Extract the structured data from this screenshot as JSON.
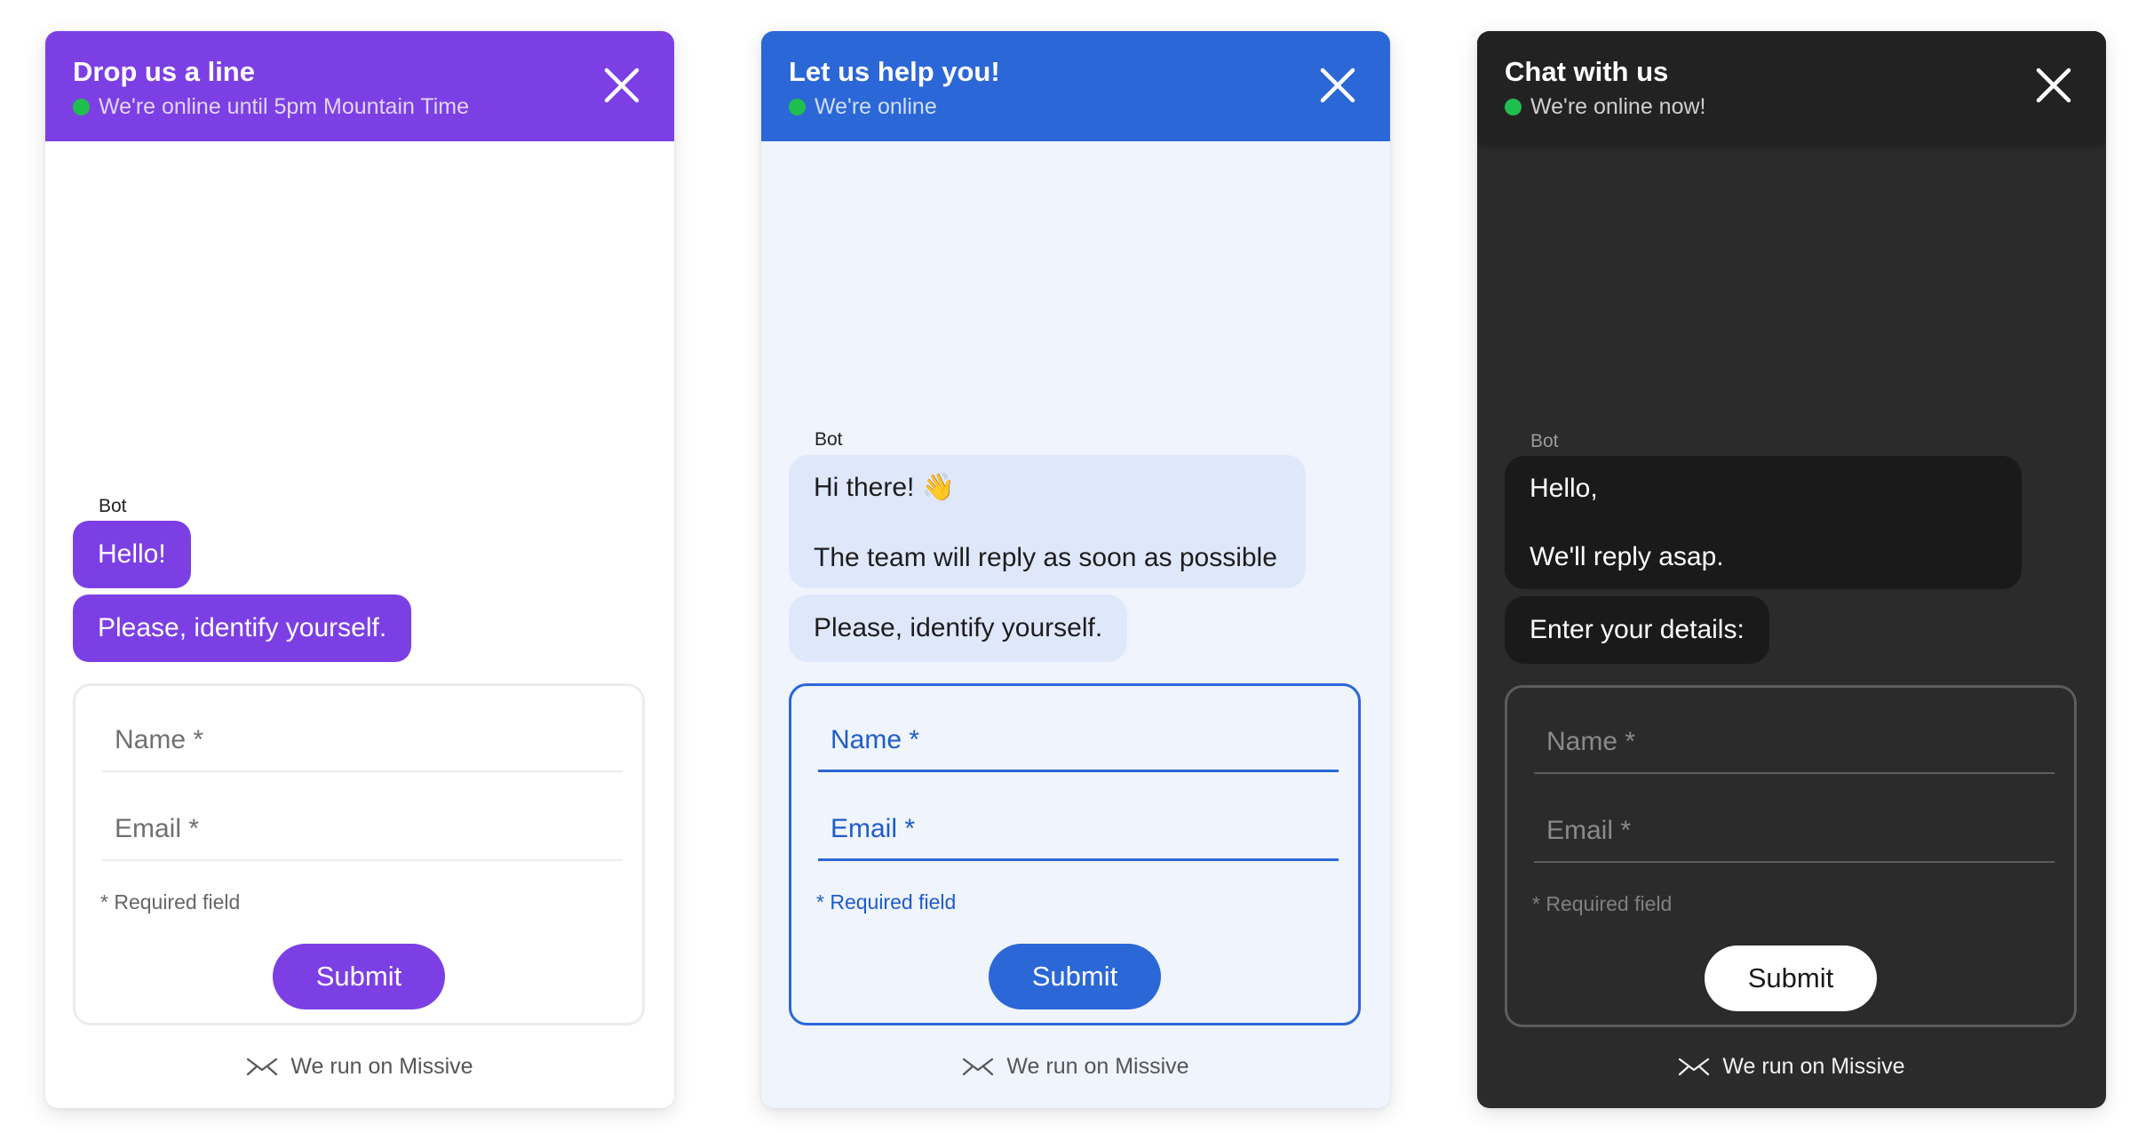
{
  "widgets": [
    {
      "title": "Drop us a line",
      "status": "We're online until 5pm Mountain Time",
      "bot_label": "Bot",
      "messages": [
        "Hello!",
        "Please, identify yourself."
      ],
      "form": {
        "name_placeholder": "Name *",
        "email_placeholder": "Email *",
        "required_note": "* Required field",
        "submit_label": "Submit"
      },
      "footer": "We run on Missive",
      "accent": "#7c3fe4",
      "theme": "light"
    },
    {
      "title": "Let us help you!",
      "status": "We're online",
      "bot_label": "Bot",
      "messages": [
        {
          "lines": [
            "Hi there! 👋",
            "The team will reply as soon as possible"
          ]
        },
        "Please, identify yourself."
      ],
      "form": {
        "name_placeholder": "Name *",
        "email_placeholder": "Email *",
        "required_note": "* Required field",
        "submit_label": "Submit"
      },
      "footer": "We run on Missive",
      "accent": "#2b67d6",
      "theme": "light-blue"
    },
    {
      "title": "Chat with us",
      "status": "We're online now!",
      "bot_label": "Bot",
      "messages": [
        {
          "lines": [
            "Hello,",
            "We'll reply asap."
          ]
        },
        "Enter your details:"
      ],
      "form": {
        "name_placeholder": "Name *",
        "email_placeholder": "Email *",
        "required_note": "* Required field",
        "submit_label": "Submit"
      },
      "footer": "We run on Missive",
      "accent": "#222222",
      "theme": "dark"
    }
  ],
  "status_dot_color": "#1fbf4f",
  "icons": {
    "close": "close-icon",
    "status": "online-dot-icon",
    "footer": "missive-logo-icon"
  }
}
